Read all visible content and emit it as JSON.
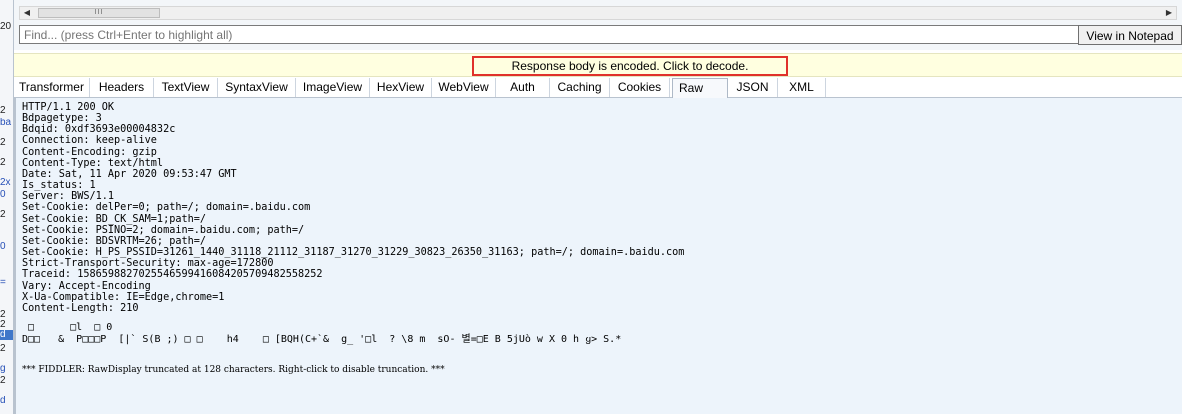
{
  "sessions_gutter": [
    "20",
    "2",
    "ba",
    "2",
    "2",
    "2x",
    "0",
    "2",
    "0",
    "=",
    "2",
    "2",
    "d",
    "2",
    "g",
    "2",
    "d"
  ],
  "toolbar": {
    "scroll_grip": "III",
    "find_placeholder": "Find... (press Ctrl+Enter to highlight all)",
    "view_notepad_label": "View in Notepad"
  },
  "banner": {
    "message": "Response body is encoded. Click to decode."
  },
  "tabs": [
    "Transformer",
    "Headers",
    "TextView",
    "SyntaxView",
    "ImageView",
    "HexView",
    "WebView",
    "Auth",
    "Caching",
    "Cookies",
    "Raw",
    "JSON",
    "XML"
  ],
  "active_tab": "Raw",
  "response": {
    "headers": [
      "HTTP/1.1 200 OK",
      "Bdpagetype: 3",
      "Bdqid: 0xdf3693e00004832c",
      "Connection: keep-alive",
      "Content-Encoding: gzip",
      "Content-Type: text/html",
      "Date: Sat, 11 Apr 2020 09:53:47 GMT",
      "Is_status: 1",
      "Server: BWS/1.1",
      "Set-Cookie: delPer=0; path=/; domain=.baidu.com",
      "Set-Cookie: BD_CK_SAM=1;path=/",
      "Set-Cookie: PSINO=2; domain=.baidu.com; path=/",
      "Set-Cookie: BDSVRTM=26; path=/",
      "Set-Cookie: H_PS_PSSID=31261_1440_31118_21112_31187_31270_31229_30823_26350_31163; path=/; domain=.baidu.com",
      "Strict-Transport-Security: max-age=172800",
      "Traceid: 1586598827025546599416084205709482558252",
      "Vary: Accept-Encoding",
      "X-Ua-Compatible: IE=Edge,chrome=1",
      "Content-Length: 210"
    ],
    "body_lines": [
      " □      □l  □ 0",
      "D□□   &  P□□□P  [|` S(B ;) □ □    h4    □ [BQH(C+`&  g_ '□l  ? \\8 m  sO- 별=□E B 5jUò w X 0 h ყ> S.*"
    ],
    "truncation_note": "*** FIDDLER: RawDisplay truncated at 128 characters. Right-click to disable truncation. ***"
  }
}
